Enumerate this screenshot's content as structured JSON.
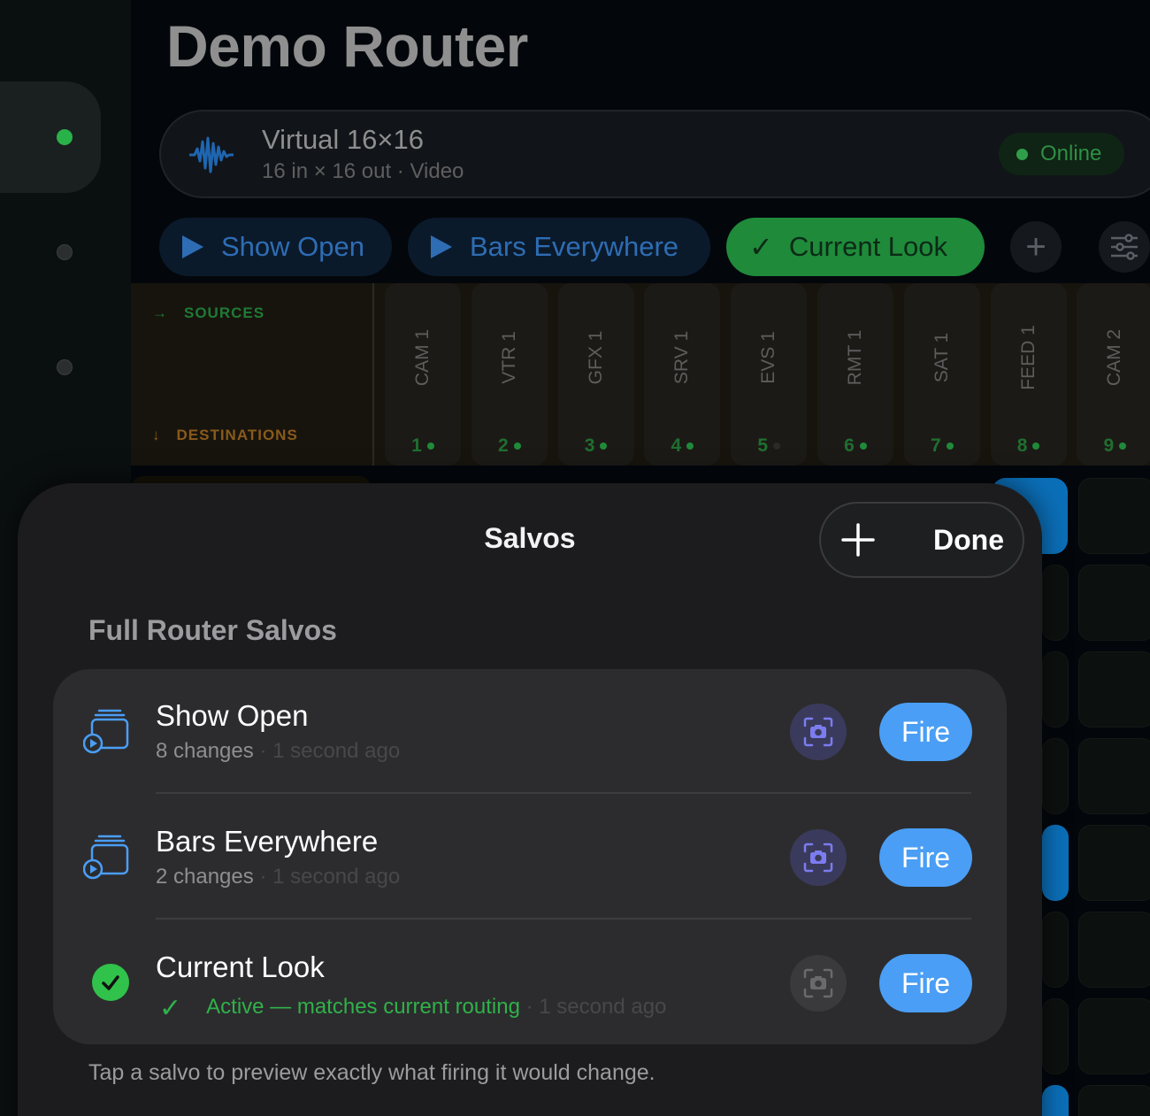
{
  "app": {
    "title": "Demo Router",
    "router": {
      "name": "Virtual 16×16",
      "subtitle": "16 in × 16 out · Video",
      "status": "Online",
      "icon": "waveform-icon"
    },
    "salvo_chips": [
      {
        "label": "Show Open",
        "icon": "play-icon",
        "active": false
      },
      {
        "label": "Bars Everywhere",
        "icon": "play-icon",
        "active": false
      },
      {
        "label": "Current Look",
        "icon": "checkmark-icon",
        "active": true
      }
    ],
    "toolbar_icons": [
      "plus-icon",
      "sliders-icon"
    ]
  },
  "matrix": {
    "sources_label": "SOURCES",
    "destinations_label": "DESTINATIONS",
    "columns": [
      {
        "name": "CAM 1",
        "num": "1",
        "signal": true
      },
      {
        "name": "VTR 1",
        "num": "2",
        "signal": true
      },
      {
        "name": "GFX 1",
        "num": "3",
        "signal": true
      },
      {
        "name": "SRV 1",
        "num": "4",
        "signal": true
      },
      {
        "name": "EVS 1",
        "num": "5",
        "signal": false
      },
      {
        "name": "RMT 1",
        "num": "6",
        "signal": true
      },
      {
        "name": "SAT 1",
        "num": "7",
        "signal": true
      },
      {
        "name": "FEED 1",
        "num": "8",
        "signal": true
      },
      {
        "name": "CAM 2",
        "num": "9",
        "signal": true
      }
    ]
  },
  "sheet": {
    "title": "Salvos",
    "done_label": "Done",
    "add_icon": "plus-icon",
    "section_title": "Full Router Salvos",
    "salvos": [
      {
        "name": "Show Open",
        "meta": "8 changes",
        "time": "· 1 second ago",
        "icon": "salvo-stack-icon",
        "fire_label": "Fire"
      },
      {
        "name": "Bars Everywhere",
        "meta": "2 changes",
        "time": "· 1 second ago",
        "icon": "salvo-stack-icon",
        "fire_label": "Fire"
      },
      {
        "name": "Current Look",
        "meta": "Active — matches current routing",
        "time": "· 1 second ago",
        "icon": "checkmark-circle-icon",
        "fire_label": "Fire",
        "active": true
      }
    ],
    "footer": "Tap a salvo to preview exactly what firing it would change."
  },
  "colors": {
    "accent_blue": "#4a9ef5",
    "active_green": "#30c24a",
    "sheet_bg": "#1c1c1e",
    "card_bg": "#2c2c2e"
  }
}
